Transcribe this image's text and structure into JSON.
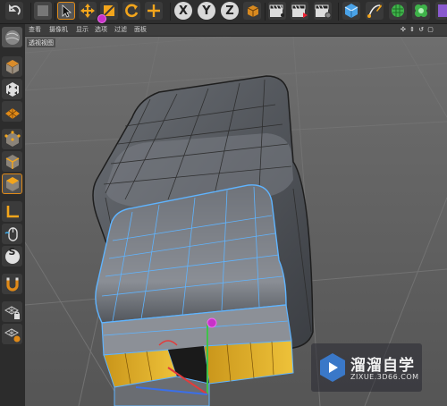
{
  "menu": {
    "items": [
      "查看",
      "摄像机",
      "显示",
      "选项",
      "过滤",
      "面板"
    ]
  },
  "viewport": {
    "label": "透视视图",
    "nav_icons": "✣ ⇕ ↺ ▢"
  },
  "toolbar": {
    "axis_x": "X",
    "axis_y": "Y",
    "axis_z": "Z"
  },
  "sidebar": {
    "snap_label": "S"
  },
  "watermark": {
    "title": "溜溜自学",
    "url": "ZIXUE.3D66.COM"
  },
  "colors": {
    "accent_orange": "#f0a020",
    "selection_blue": "#5fb4ff",
    "cursor_magenta": "#c832c8",
    "highlight_yellow": "#e0b828"
  }
}
